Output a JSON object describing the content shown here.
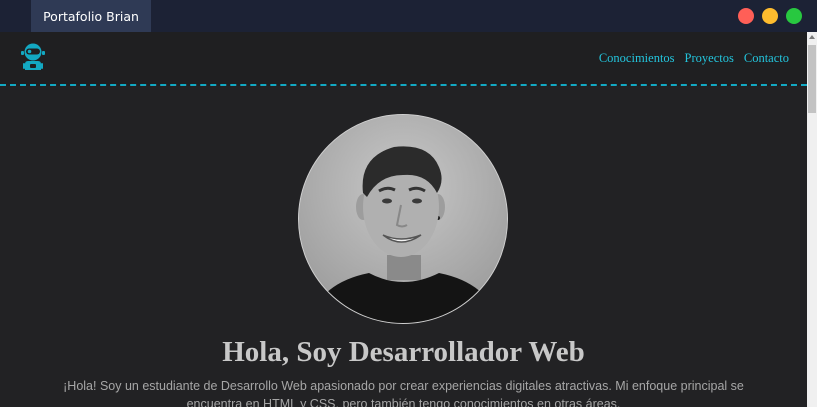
{
  "window": {
    "tab_title": "Portafolio Brian",
    "controls": {
      "close_color": "#ff5f57",
      "minimize_color": "#febc2e",
      "maximize_color": "#28c840"
    }
  },
  "navbar": {
    "logo_icon": "robot-icon",
    "accent_color": "#13a8c2",
    "links": [
      {
        "label": "Conocimientos"
      },
      {
        "label": "Proyectos"
      },
      {
        "label": "Contacto"
      }
    ]
  },
  "hero": {
    "avatar_icon": "profile-photo",
    "headline": "Hola, Soy Desarrollador Web",
    "intro": "¡Hola! Soy un estudiante de Desarrollo Web apasionado por crear experiencias digitales atractivas. Mi enfoque principal se encuentra en HTML y CSS, pero también tengo conocimientos en otras áreas."
  }
}
